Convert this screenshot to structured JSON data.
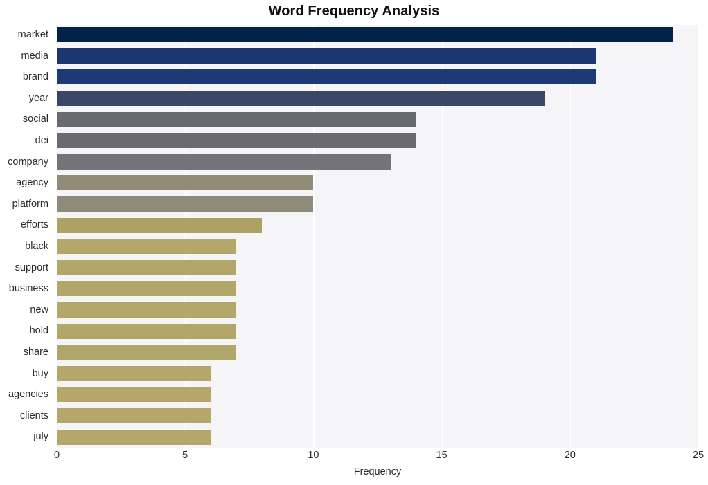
{
  "chart_data": {
    "type": "bar",
    "orientation": "horizontal",
    "title": "Word Frequency Analysis",
    "xlabel": "Frequency",
    "ylabel": "",
    "categories": [
      "market",
      "media",
      "brand",
      "year",
      "social",
      "dei",
      "company",
      "agency",
      "platform",
      "efforts",
      "black",
      "support",
      "business",
      "new",
      "hold",
      "share",
      "buy",
      "agencies",
      "clients",
      "july"
    ],
    "values": [
      24,
      21,
      21,
      19,
      14,
      14,
      13,
      10,
      10,
      8,
      7,
      7,
      7,
      7,
      7,
      7,
      6,
      6,
      6,
      6
    ],
    "bar_colors": [
      "#032249",
      "#1c3671",
      "#1c3a78",
      "#394868",
      "#696a71",
      "#6a6b71",
      "#737479",
      "#918b78",
      "#8e8a7c",
      "#ada163",
      "#b3a76a",
      "#b2a669",
      "#b2a669",
      "#b3a76a",
      "#b2a669",
      "#b0a56b",
      "#b5a769",
      "#b5a769",
      "#b5a769",
      "#b5a769"
    ],
    "xlim": [
      0,
      25
    ],
    "xticks": [
      0,
      5,
      10,
      15,
      20,
      25
    ],
    "xtick_labels": [
      "0",
      "5",
      "10",
      "15",
      "20",
      "25"
    ],
    "gridlines": "vertical-white",
    "legend": null,
    "plot_background": "#f5f5f7",
    "figure_background": "#ffffff"
  }
}
